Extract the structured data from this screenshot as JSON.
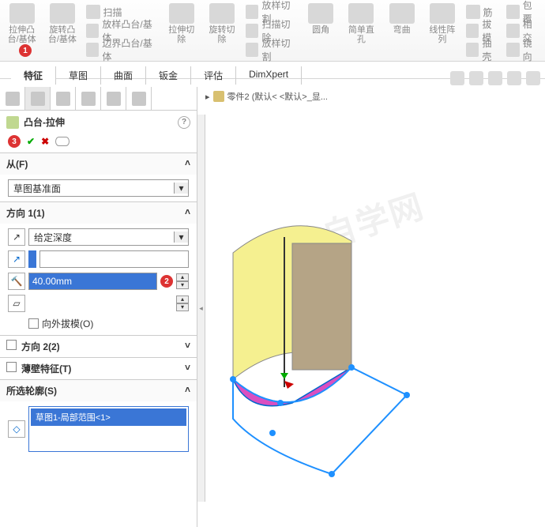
{
  "ribbon": {
    "big": [
      {
        "label": "拉伸凸台/基体"
      },
      {
        "label": "旋转凸台/基体"
      }
    ],
    "small": [
      {
        "label": "扫描"
      },
      {
        "label": "放样凸台/基体"
      },
      {
        "label": "边界凸台/基体"
      }
    ],
    "big2": [
      {
        "label": "拉伸切除"
      },
      {
        "label": "旋转切除"
      }
    ],
    "small2": [
      {
        "label": "放样切割"
      },
      {
        "label": "扫描切除"
      },
      {
        "label": "放样切割"
      }
    ],
    "big3": [
      {
        "label": "圆角"
      },
      {
        "label": "简单直孔"
      },
      {
        "label": "弯曲"
      }
    ],
    "big4": [
      {
        "label": "线性阵列"
      }
    ],
    "small3": [
      {
        "label": "筋"
      },
      {
        "label": "拔模"
      },
      {
        "label": "抽壳"
      }
    ],
    "small4": [
      {
        "label": "包覆"
      },
      {
        "label": "相交"
      },
      {
        "label": "镜向"
      }
    ]
  },
  "tabs": [
    "特征",
    "草图",
    "曲面",
    "钣金",
    "评估",
    "DimXpert"
  ],
  "breadcrumb": "零件2  (默认< <默认>_显...",
  "feature": {
    "title": "凸台-拉伸",
    "from_label": "从(F)",
    "from_value": "草图基准面",
    "dir_label": "方向 1(1)",
    "end_value": "给定深度",
    "depth_value": "40.00mm",
    "draft_label": "向外拔模(O)",
    "dir2_label": "方向 2(2)",
    "thin_label": "薄壁特征(T)",
    "contours_label": "所选轮廓(S)",
    "contour_item": "草图1-局部范围<1>"
  },
  "markers": {
    "m1": "1",
    "m2": "2",
    "m3": "3"
  },
  "watermark": "软件自学网"
}
